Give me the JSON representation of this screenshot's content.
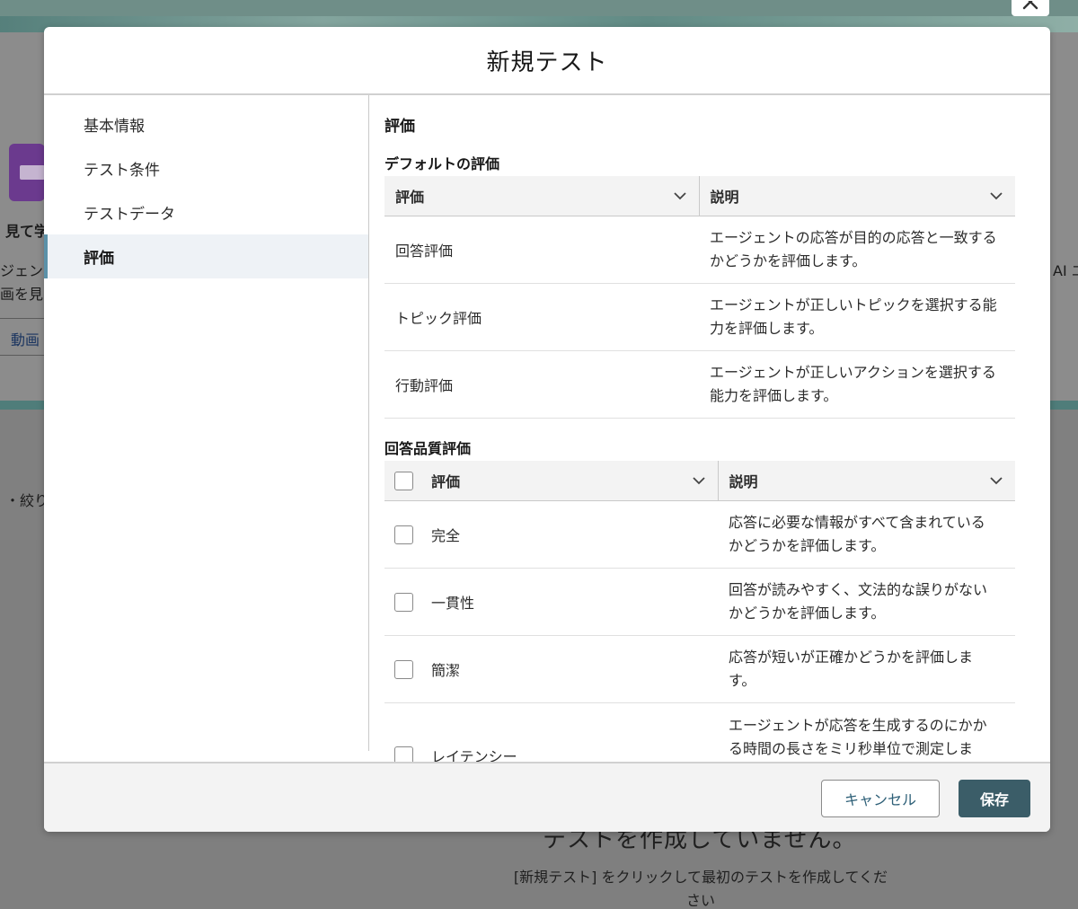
{
  "background": {
    "partial_texts": [
      "見て学",
      "ジェント",
      "画を見な",
      "・絞り",
      "AI エ"
    ],
    "link_text": "動画",
    "empty_title": "テストを作成していません。",
    "empty_message": "[新規テスト] をクリックして最初のテストを作成してください"
  },
  "modal": {
    "title": "新規テスト",
    "close_icon": "close-icon",
    "nav": [
      {
        "label": "基本情報",
        "active": false
      },
      {
        "label": "テスト条件",
        "active": false
      },
      {
        "label": "テストデータ",
        "active": false
      },
      {
        "label": "評価",
        "active": true
      }
    ],
    "section_title": "評価",
    "default_eval": {
      "title": "デフォルトの評価",
      "columns": [
        "評価",
        "説明"
      ],
      "rows": [
        {
          "name": "回答評価",
          "description": "エージェントの応答が目的の応答と一致するかどうかを評価します。"
        },
        {
          "name": "トピック評価",
          "description": "エージェントが正しいトピックを選択する能力を評価します。"
        },
        {
          "name": "行動評価",
          "description": "エージェントが正しいアクションを選択する能力を評価します。"
        }
      ]
    },
    "quality_eval": {
      "title": "回答品質評価",
      "columns": [
        "評価",
        "説明"
      ],
      "rows": [
        {
          "name": "完全",
          "description": "応答に必要な情報がすべて含まれているかどうかを評価します。",
          "checked": false
        },
        {
          "name": "一貫性",
          "description": "回答が読みやすく、文法的な誤りがないかどうかを評価します。",
          "checked": false
        },
        {
          "name": "簡潔",
          "description": "応答が短いが正確かどうかを評価します。",
          "checked": false
        },
        {
          "name": "レイテンシー",
          "description": "エージェントが応答を生成するのにかかる時間の長さをミリ秒単位で測定します。",
          "checked": false
        }
      ]
    },
    "footer": {
      "cancel_label": "キャンセル",
      "save_label": "保存"
    }
  }
}
